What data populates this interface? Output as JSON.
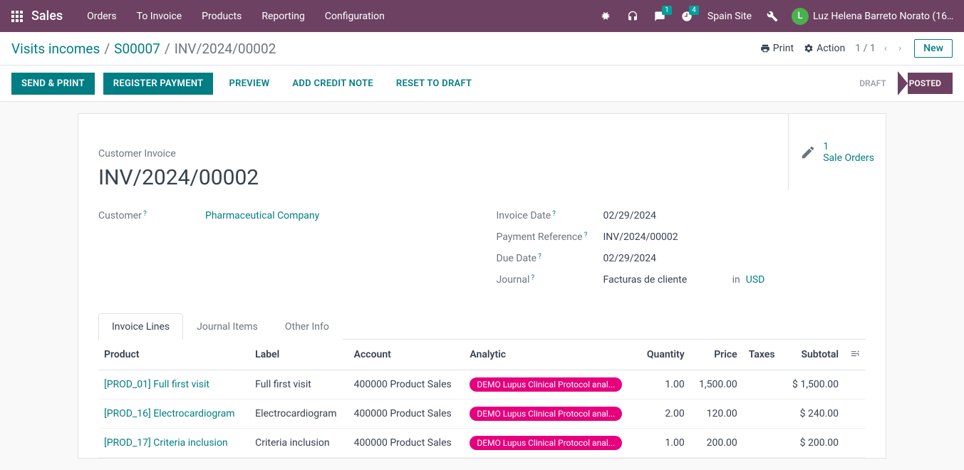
{
  "topbar": {
    "app_name": "Sales",
    "nav": [
      "Orders",
      "To Invoice",
      "Products",
      "Reporting",
      "Configuration"
    ],
    "messages_badge": "1",
    "activities_badge": "4",
    "site": "Spain Site",
    "user_initial": "L",
    "user_name": "Luz Helena Barreto Norato (16-sweet-b..."
  },
  "breadcrumb": {
    "parts": [
      "Visits incomes",
      "S00007",
      "INV/2024/00002"
    ]
  },
  "header_actions": {
    "print": "Print",
    "action": "Action",
    "pager": "1 / 1",
    "new": "New"
  },
  "buttons": {
    "send_print": "SEND & PRINT",
    "register_payment": "REGISTER PAYMENT",
    "preview": "PREVIEW",
    "add_credit_note": "ADD CREDIT NOTE",
    "reset_draft": "RESET TO DRAFT"
  },
  "status": {
    "draft": "DRAFT",
    "posted": "POSTED"
  },
  "stat": {
    "num": "1",
    "label": "Sale Orders"
  },
  "invoice": {
    "label": "Customer Invoice",
    "name": "INV/2024/00002",
    "customer_label": "Customer",
    "customer": "Pharmaceutical Company",
    "invoice_date_label": "Invoice Date",
    "invoice_date": "02/29/2024",
    "payment_ref_label": "Payment Reference",
    "payment_ref": "INV/2024/00002",
    "due_date_label": "Due Date",
    "due_date": "02/29/2024",
    "journal_label": "Journal",
    "journal": "Facturas de cliente",
    "in": "in",
    "currency": "USD"
  },
  "tabs": [
    "Invoice Lines",
    "Journal Items",
    "Other Info"
  ],
  "table": {
    "headers": {
      "product": "Product",
      "label": "Label",
      "account": "Account",
      "analytic": "Analytic",
      "quantity": "Quantity",
      "price": "Price",
      "taxes": "Taxes",
      "subtotal": "Subtotal"
    },
    "rows": [
      {
        "product": "[PROD_01] Full first visit",
        "label": "Full first visit",
        "account": "400000 Product Sales",
        "analytic": "DEMO Lupus Clinical Protocol anal...",
        "quantity": "1.00",
        "price": "1,500.00",
        "taxes": "",
        "subtotal": "$ 1,500.00"
      },
      {
        "product": "[PROD_16] Electrocardiogram",
        "label": "Electrocardiogram",
        "account": "400000 Product Sales",
        "analytic": "DEMO Lupus Clinical Protocol anal...",
        "quantity": "2.00",
        "price": "120.00",
        "taxes": "",
        "subtotal": "$ 240.00"
      },
      {
        "product": "[PROD_17] Criteria inclusion",
        "label": "Criteria inclusion",
        "account": "400000 Product Sales",
        "analytic": "DEMO Lupus Clinical Protocol anal...",
        "quantity": "1.00",
        "price": "200.00",
        "taxes": "",
        "subtotal": "$ 200.00"
      }
    ]
  }
}
